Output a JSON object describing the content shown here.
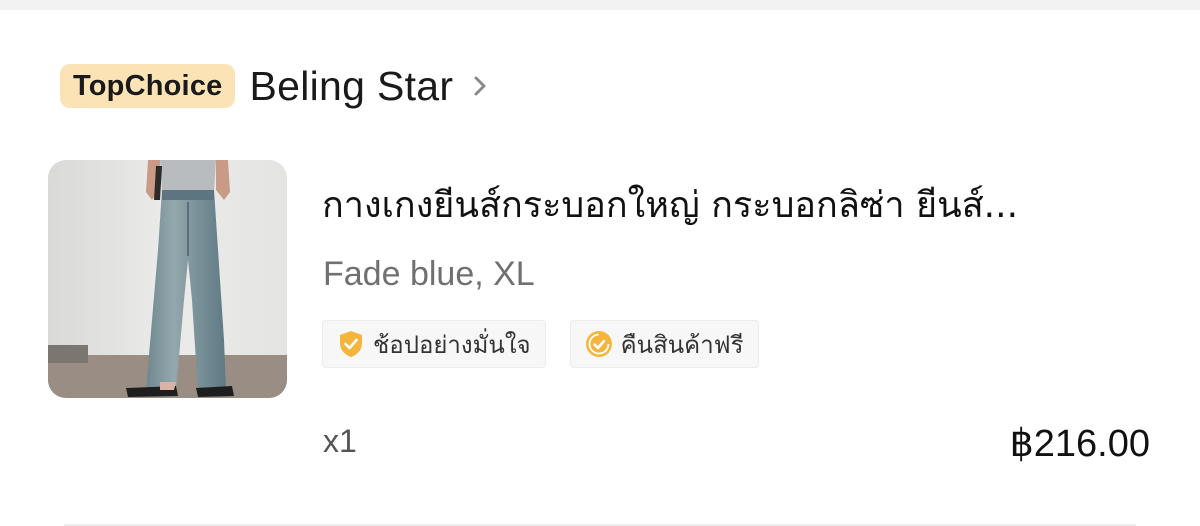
{
  "shop": {
    "badge": "TopChoice",
    "name": "Beling Star"
  },
  "product": {
    "title": "กางเกงยีนส์กระบอกใหญ่ กระบอกลิซ่า ยีนส์...",
    "variant": "Fade blue, XL",
    "quantity": "x1",
    "price": "฿216.00"
  },
  "tags": [
    {
      "icon": "shield-check-icon",
      "label": "ช้อปอย่างมั่นใจ"
    },
    {
      "icon": "return-check-icon",
      "label": "คืนสินค้าฟรี"
    }
  ],
  "colors": {
    "badge_bg": "#fce3b6",
    "icon_orange": "#f5b53c"
  }
}
